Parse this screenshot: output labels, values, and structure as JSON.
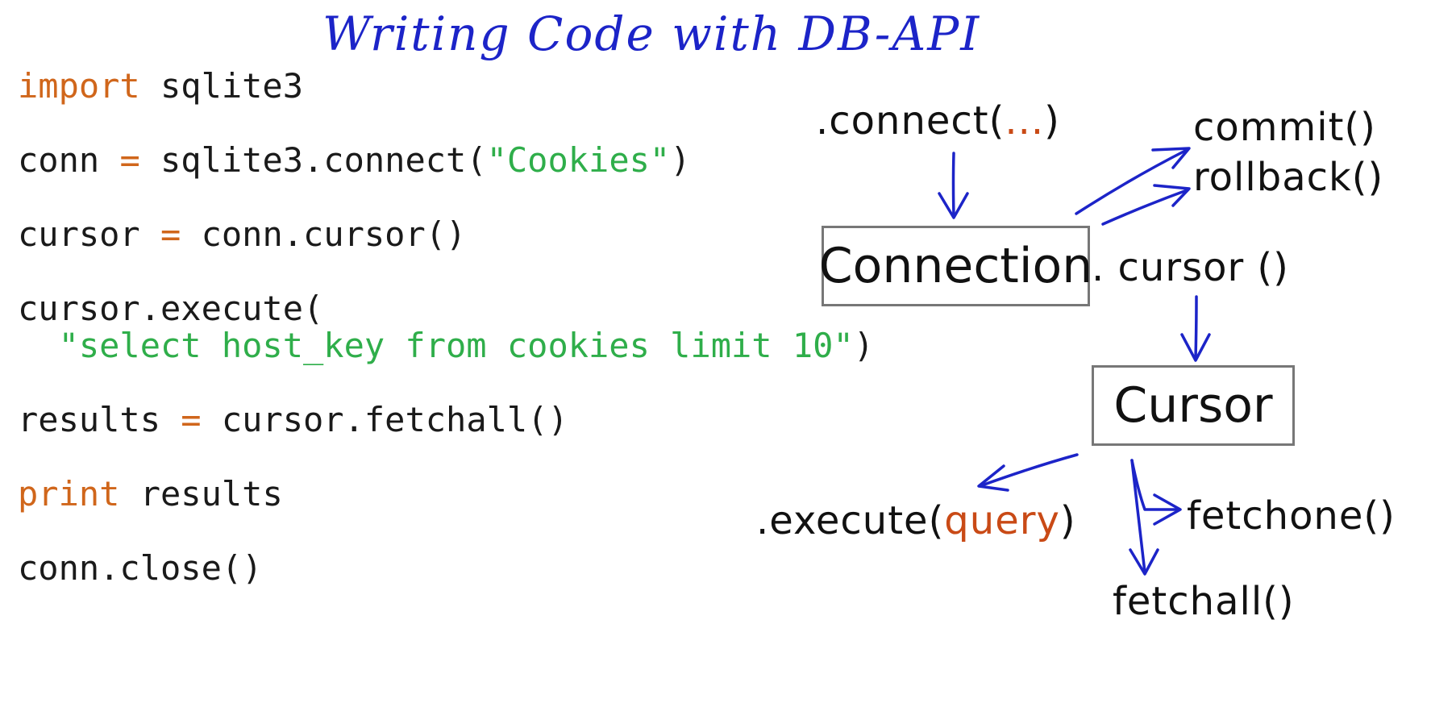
{
  "title": "Writing Code with DB-API",
  "code": {
    "line1": {
      "kw": "import",
      "rest": " sqlite3"
    },
    "line2": {
      "a": "conn ",
      "op": "=",
      "b": " sqlite3.connect(",
      "str": "\"Cookies\"",
      "c": ")"
    },
    "line3": {
      "a": "cursor ",
      "op": "=",
      "b": " conn.cursor()"
    },
    "line4": "cursor.execute(",
    "line5": {
      "str": "  \"select host_key from cookies limit 10\"",
      "c": ")"
    },
    "line6": {
      "a": "results ",
      "op": "=",
      "b": " cursor.fetchall()"
    },
    "line7": {
      "kw": "print",
      "rest": " results"
    },
    "line8": "conn.close()"
  },
  "diagram": {
    "connect": {
      "prefix": ".connect(",
      "args": "...",
      "suffix": ")"
    },
    "commit": "commit()",
    "rollback": "rollback()",
    "connection_box": "Connection",
    "cursor_method": ". cursor ()",
    "cursor_box": "Cursor",
    "execute": {
      "prefix": ".execute(",
      "arg": "query",
      "suffix": ")"
    },
    "fetchone": "fetchone()",
    "fetchall": "fetchall()"
  },
  "colors": {
    "title": "#1c24c8",
    "arrows": "#1c24c8",
    "keyword": "#d0661b",
    "string": "#2fae4a",
    "highlight": "#c94a16",
    "box_border": "#777777"
  }
}
